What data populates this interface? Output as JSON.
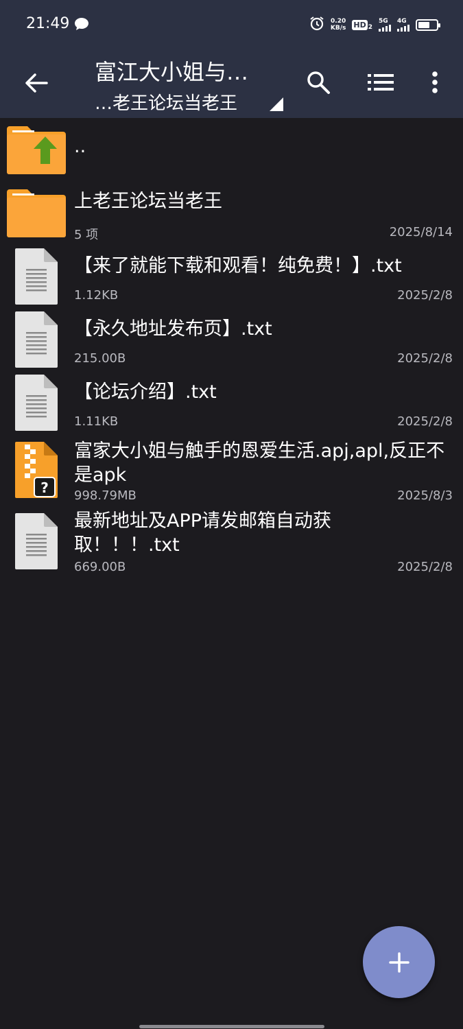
{
  "status": {
    "time": "21:49",
    "net_speed_top": "0.20",
    "net_speed_bottom": "KB/s",
    "hd_label": "HD",
    "hd_sub": "2",
    "sig1_label": "5G",
    "sig2_label": "4G"
  },
  "appbar": {
    "title": "富江大小姐与…",
    "subtitle": "…老王论坛当老王"
  },
  "items": [
    {
      "name": "..",
      "meta": "",
      "date": "",
      "type": "parent-folder"
    },
    {
      "name": "上老王论坛当老王",
      "meta": "5 项",
      "date": "2025/8/14",
      "type": "folder"
    },
    {
      "name": "【来了就能下载和观看！纯免费！】.txt",
      "meta": "1.12KB",
      "date": "2025/2/8",
      "type": "text"
    },
    {
      "name": "【永久地址发布页】.txt",
      "meta": "215.00B",
      "date": "2025/2/8",
      "type": "text"
    },
    {
      "name": "【论坛介绍】.txt",
      "meta": "1.11KB",
      "date": "2025/2/8",
      "type": "text"
    },
    {
      "name": "富家大小姐与触手的恩爱生活.apj,apl,反正不是apk",
      "meta": "998.79MB",
      "date": "2025/8/3",
      "type": "archive"
    },
    {
      "name": "最新地址及APP请发邮箱自动获取！！！.txt",
      "meta": "669.00B",
      "date": "2025/2/8",
      "type": "text"
    }
  ],
  "colors": {
    "appbar": "#2c3143",
    "background": "#1c1b1f",
    "folder": "#f7a02a",
    "fab": "#7f8ccb"
  }
}
